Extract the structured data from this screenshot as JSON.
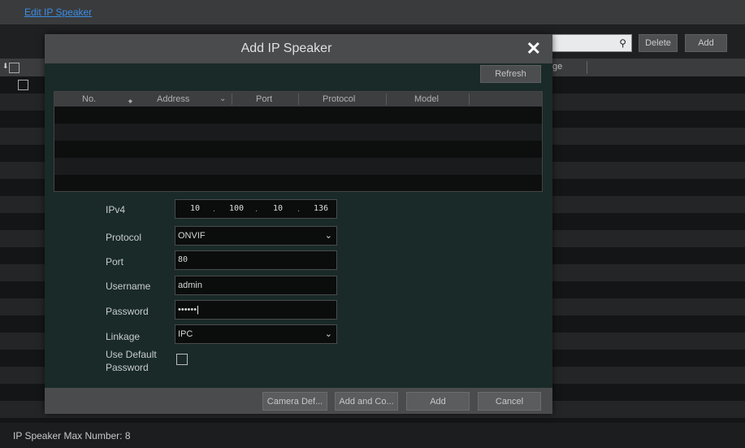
{
  "page": {
    "breadcrumb_link": "Edit IP Speaker"
  },
  "toolbar": {
    "search_placeholder": "",
    "delete_label": "Delete",
    "add_label": "Add"
  },
  "list": {
    "header_partial": "ge"
  },
  "footer": {
    "max_number_text": "IP Speaker Max Number: 8"
  },
  "dialog": {
    "title": "Add IP Speaker",
    "refresh_label": "Refresh",
    "table": {
      "columns": [
        "No.",
        "Address",
        "Port",
        "Protocol",
        "Model"
      ],
      "rows": []
    },
    "form": {
      "ipv4_label": "IPv4",
      "ipv4": [
        "10",
        "100",
        "10",
        "136"
      ],
      "protocol_label": "Protocol",
      "protocol_value": "ONVIF",
      "port_label": "Port",
      "port_value": "80",
      "username_label": "Username",
      "username_value": "admin",
      "password_label": "Password",
      "password_value": "••••••",
      "linkage_label": "Linkage",
      "linkage_value": "IPC",
      "use_default_label_1": "Use Default",
      "use_default_label_2": "Password",
      "use_default_checked": false
    },
    "buttons": {
      "camera_default": "Camera Def...",
      "add_and_continue": "Add and Co...",
      "add": "Add",
      "cancel": "Cancel"
    }
  }
}
